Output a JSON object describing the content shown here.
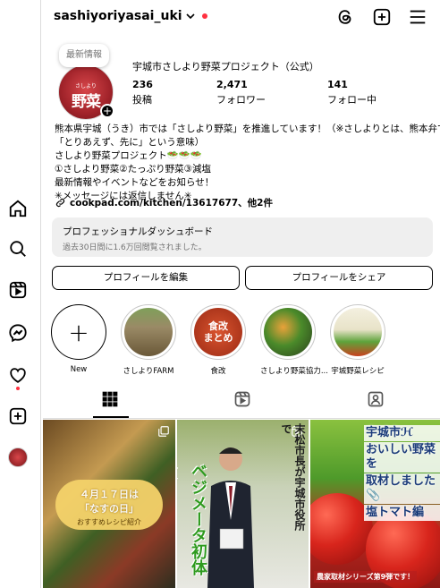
{
  "header": {
    "username": "sashiyoriyasai_uki"
  },
  "profile": {
    "note": "最新情報",
    "avatar_main": "野菜",
    "avatar_small": "さしより",
    "display_name": "宇城市さしより野菜プロジェクト（公式）",
    "stats": [
      {
        "num": "236",
        "label": "投稿"
      },
      {
        "num": "2,471",
        "label": "フォロワー"
      },
      {
        "num": "141",
        "label": "フォロー中"
      }
    ],
    "bio_lines": [
      "熊本県宇城（うき）市では「さしより野菜」を推進しています！（※さしよりとは、熊本弁で",
      "「とりあえず、先に」という意味）",
      "さしより野菜プロジェクト🥗🥗🥗",
      "①さしより野菜②たっぷり野菜③減塩",
      "最新情報やイベントなどをお知らせ！",
      "✳︎メッセージには返信しません✳︎"
    ],
    "link": "cookpad.com/kitchen/13617677、他2件"
  },
  "dashboard": {
    "title": "プロフェッショナルダッシュボード",
    "subtitle": "過去30日間に1.6万回閲覧されました。"
  },
  "buttons": {
    "edit": "プロフィールを編集",
    "share": "プロフィールをシェア"
  },
  "highlights": [
    {
      "label": "New"
    },
    {
      "label": "さしよりFARM"
    },
    {
      "label": "食改",
      "cover_text_1": "食改",
      "cover_text_2": "まとめ"
    },
    {
      "label": "さしより野菜協力..."
    },
    {
      "label": "宇城野菜レシピ"
    }
  ],
  "posts": [
    {
      "line1": "４月１７日は",
      "line2": "「なすの日」",
      "line3": "おすすめレシピ紹介"
    },
    {
      "title": "末松市長が宇城市役所で",
      "green": "ベジメータ初体験"
    },
    {
      "lines": [
        "宇城市ℋ",
        "おいしい野菜を",
        "取材しました📎",
        "塩トマト編"
      ],
      "footer": "農家取材シリーズ第9弾です！"
    }
  ],
  "colors": {
    "accent_red": "#ff3040",
    "divider": "#dbdbdb",
    "muted": "#737373"
  }
}
